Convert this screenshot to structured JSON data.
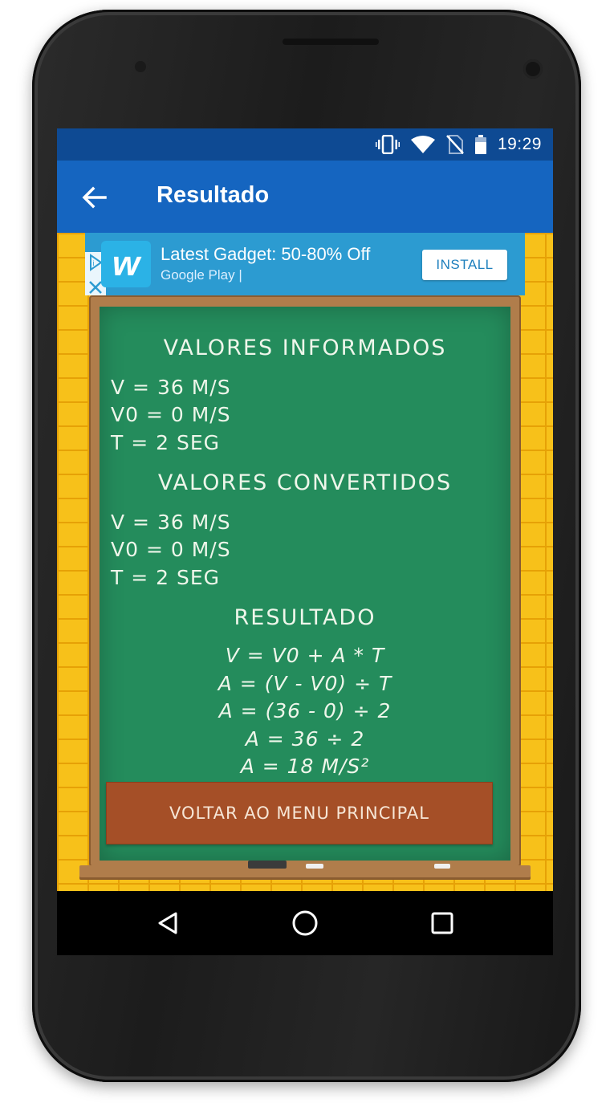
{
  "status_bar": {
    "time": "19:29",
    "icons": [
      "vibrate-icon",
      "wifi-icon",
      "no-sim-icon",
      "battery-icon"
    ]
  },
  "app_bar": {
    "title": "Resultado",
    "back_icon": "arrow-back-icon",
    "color": "#1565c0"
  },
  "ad": {
    "title": "Latest Gadget: 50-80% Off",
    "subtitle": "Google Play  |",
    "install_label": "INSTALL",
    "logo_letter": "w"
  },
  "board": {
    "informed_heading": "VALORES INFORMADOS",
    "informed": [
      "V = 36 M/S",
      "V0 = 0 M/S",
      "T = 2 SEG"
    ],
    "converted_heading": "VALORES CONVERTIDOS",
    "converted": [
      "V = 36 M/S",
      "V0 = 0 M/S",
      "T = 2 SEG"
    ],
    "result_heading": "RESULTADO",
    "result": [
      "V = V0 + A * T",
      "A = (V - V0) ÷ T",
      "A = (36 - 0) ÷ 2",
      "A = 36 ÷ 2",
      "A = 18 M/S²"
    ],
    "menu_button": "VOLTAR AO MENU PRINCIPAL"
  },
  "nav_bar": {
    "icons": [
      "back-triangle-icon",
      "home-circle-icon",
      "recents-square-icon"
    ]
  },
  "colors": {
    "status_bar": "#0e4a93",
    "chalkboard": "#248c5c",
    "menu_button": "#a54f27",
    "wall": "#f7c11a"
  }
}
